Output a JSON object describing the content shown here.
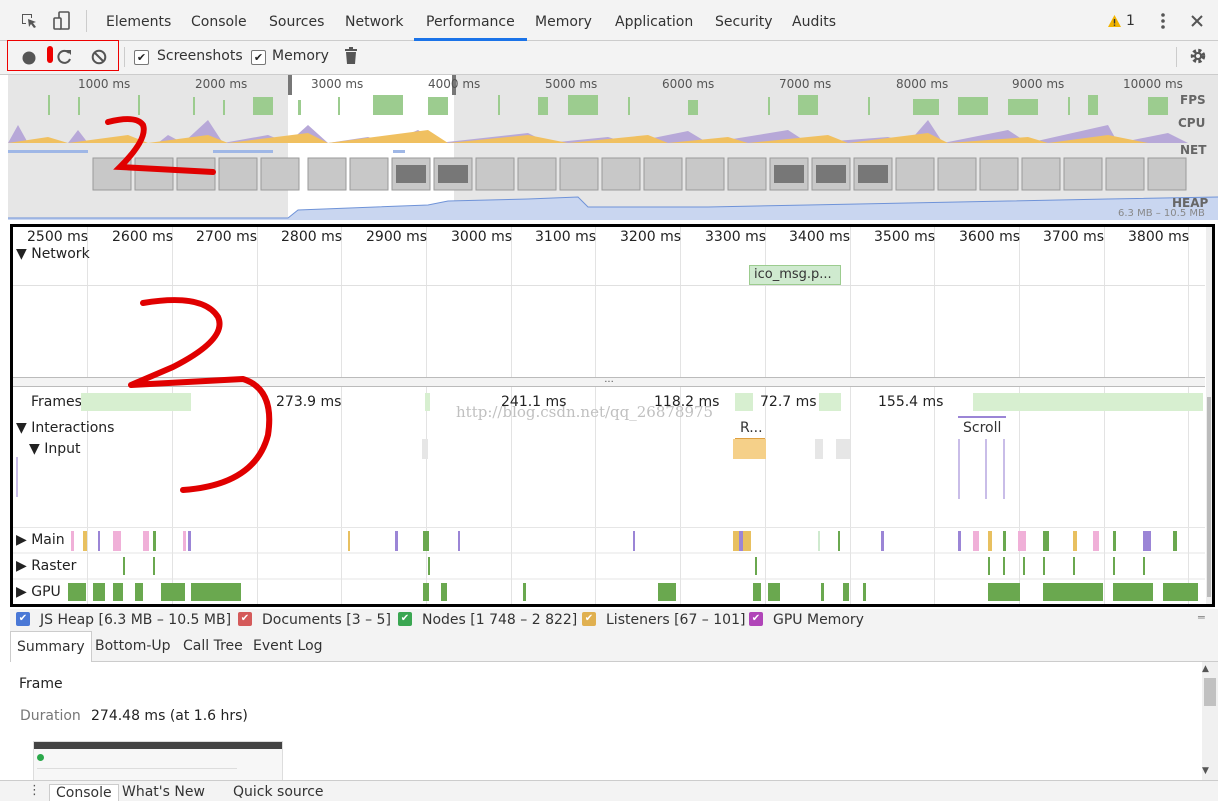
{
  "tabs": [
    "Elements",
    "Console",
    "Sources",
    "Network",
    "Performance",
    "Memory",
    "Application",
    "Security",
    "Audits"
  ],
  "active_tab": "Performance",
  "warning_count": "1",
  "toolbar": {
    "screenshots_label": "Screenshots",
    "memory_label": "Memory"
  },
  "overview": {
    "ticks": [
      "1000 ms",
      "2000 ms",
      "3000 ms",
      "4000 ms",
      "5000 ms",
      "6000 ms",
      "7000 ms",
      "8000 ms",
      "9000 ms",
      "10000 ms"
    ],
    "fps_label": "FPS",
    "cpu_label": "CPU",
    "net_label": "NET",
    "heap_label": "HEAP",
    "heap_range": "6.3 MB – 10.5 MB"
  },
  "timeline": {
    "ticks": [
      "2500 ms",
      "2600 ms",
      "2700 ms",
      "2800 ms",
      "2900 ms",
      "3000 ms",
      "3100 ms",
      "3200 ms",
      "3300 ms",
      "3400 ms",
      "3500 ms",
      "3600 ms",
      "3700 ms",
      "3800 ms"
    ],
    "network_label": "Network",
    "network_request": "ico_msg.p...",
    "frames_label": "Frames",
    "frame_durations": [
      "273.9 ms",
      "241.1 ms",
      "118.2 ms",
      "72.7 ms",
      "155.4 ms"
    ],
    "interactions_label": "Interactions",
    "input_label": "Input",
    "interaction_r": "R...",
    "interaction_scroll": "Scroll",
    "main_label": "Main",
    "raster_label": "Raster",
    "gpu_label": "GPU",
    "watermark": "http://blog.csdn.net/qq_26878975"
  },
  "legend": [
    {
      "label": "JS Heap [6.3 MB – 10.5 MB]",
      "color": "#4a78d6"
    },
    {
      "label": "Documents [3 – 5]",
      "color": "#d45a5a"
    },
    {
      "label": "Nodes [1 748 – 2 822]",
      "color": "#3aa651"
    },
    {
      "label": "Listeners [67 – 101]",
      "color": "#e0b050"
    },
    {
      "label": "GPU Memory",
      "color": "#b045b8"
    }
  ],
  "subtabs": [
    "Summary",
    "Bottom-Up",
    "Call Tree",
    "Event Log"
  ],
  "active_subtab": "Summary",
  "summary": {
    "title": "Frame",
    "duration_label": "Duration",
    "duration_value": "274.48 ms (at 1.6 hrs)"
  },
  "drawer_tabs": [
    "Console",
    "What's New",
    "Quick source"
  ],
  "colors": {
    "accent": "#1a73e8",
    "annotation_red": "#e00000",
    "frame_green": "#d7efd0",
    "gpu_green": "#6aa84f",
    "input_yellow": "#f5d089"
  }
}
